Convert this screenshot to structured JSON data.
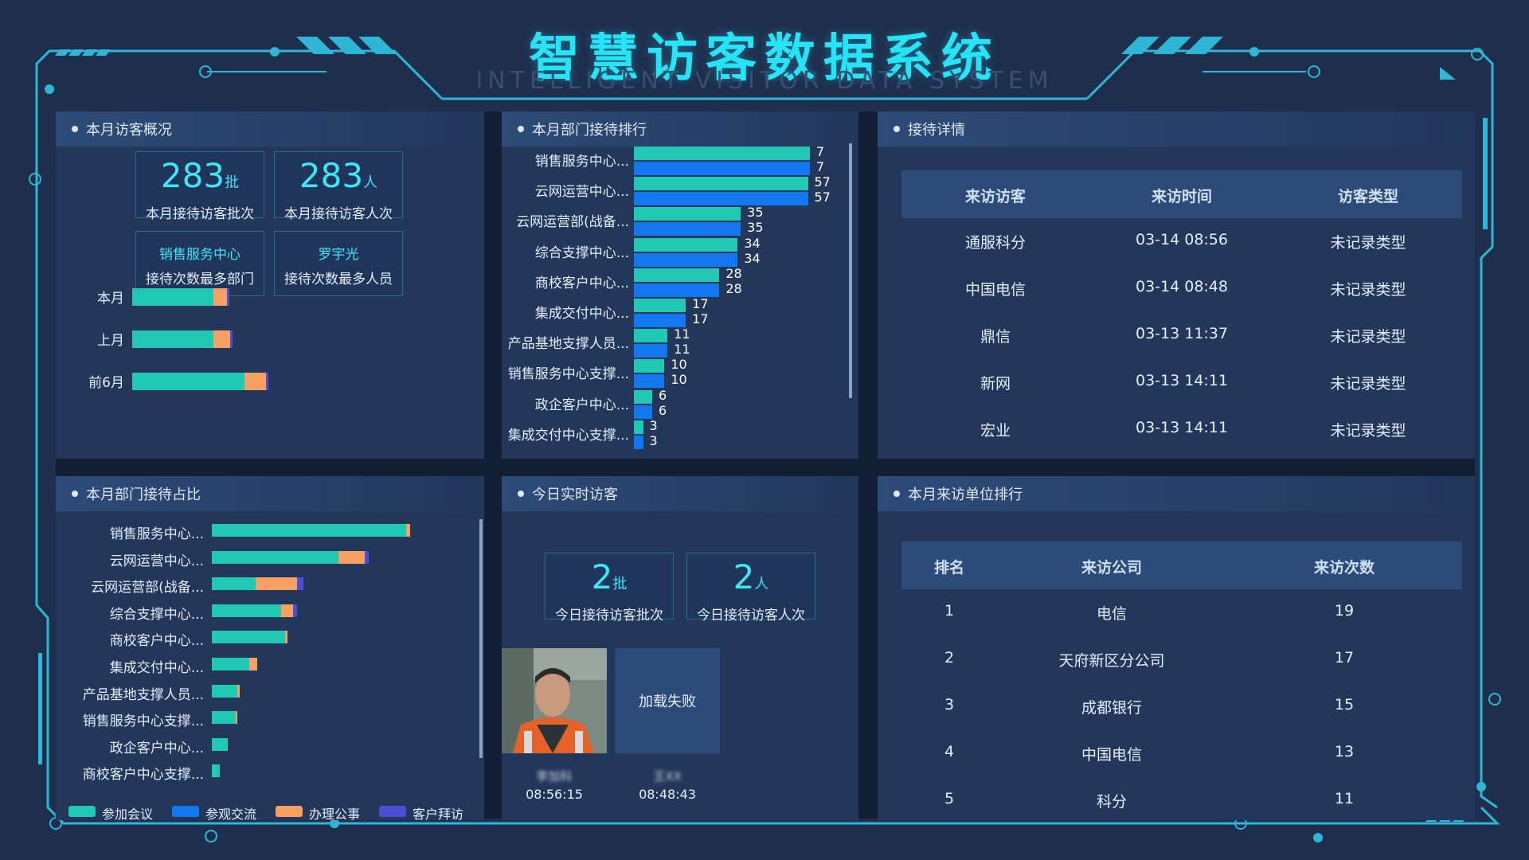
{
  "header": {
    "title": "智慧访客数据系统",
    "subtitle": "INTELLIGENT VISITOR DATA SYSTEM"
  },
  "overview": {
    "title": "本月访客概况",
    "batches": {
      "value": "283",
      "unit": "批",
      "label": "本月接待访客批次"
    },
    "people": {
      "value": "283",
      "unit": "人",
      "label": "本月接待访客人次"
    },
    "top_dept": {
      "value": "销售服务中心",
      "label": "接待次数最多部门"
    },
    "top_person": {
      "value": "罗宇光",
      "label": "接待次数最多人员"
    },
    "period_bars": [
      {
        "label": "本月",
        "segments": [
          0.68,
          0.11,
          0.02
        ]
      },
      {
        "label": "上月",
        "segments": [
          0.68,
          0.14,
          0.02
        ]
      },
      {
        "label": "前6月",
        "segments": [
          0.94,
          0.18,
          0.02
        ]
      }
    ]
  },
  "ranking": {
    "title": "本月部门接待排行",
    "items": [
      {
        "label": "销售服务中心...",
        "a": 7,
        "b": 7
      },
      {
        "label": "云网运营中心...",
        "a": 57,
        "b": 57
      },
      {
        "label": "云网运营部(战备...",
        "a": 35,
        "b": 35
      },
      {
        "label": "综合支撑中心...",
        "a": 34,
        "b": 34
      },
      {
        "label": "商校客户中心...",
        "a": 28,
        "b": 28
      },
      {
        "label": "集成交付中心...",
        "a": 17,
        "b": 17
      },
      {
        "label": "产品基地支撑人员...",
        "a": 11,
        "b": 11
      },
      {
        "label": "销售服务中心支撑...",
        "a": 10,
        "b": 10
      },
      {
        "label": "政企客户中心...",
        "a": 6,
        "b": 6
      },
      {
        "label": "集成交付中心支撑...",
        "a": 3,
        "b": 3
      }
    ],
    "first_bar_fill": [
      0.98,
      0.98
    ]
  },
  "details": {
    "title": "接待详情",
    "headers": [
      "来访访客",
      "来访时间",
      "访客类型"
    ],
    "rows": [
      [
        "通服科分",
        "03-14 08:56",
        "未记录类型"
      ],
      [
        "中国电信",
        "03-14 08:48",
        "未记录类型"
      ],
      [
        "鼎信",
        "03-13 11:37",
        "未记录类型"
      ],
      [
        "新网",
        "03-13 14:11",
        "未记录类型"
      ],
      [
        "宏业",
        "03-13 14:11",
        "未记录类型"
      ]
    ]
  },
  "ratio": {
    "title": "本月部门接待占比",
    "items": [
      {
        "label": "销售服务中心...",
        "segments": [
          0.98,
          0,
          0.02,
          0
        ]
      },
      {
        "label": "云网运营中心...",
        "segments": [
          0.64,
          0,
          0.13,
          0.02
        ]
      },
      {
        "label": "云网运营部(战备...",
        "segments": [
          0.22,
          0,
          0.21,
          0.03
        ]
      },
      {
        "label": "综合支撑中心...",
        "segments": [
          0.35,
          0,
          0.06,
          0.02
        ]
      },
      {
        "label": "商校客户中心...",
        "segments": [
          0.37,
          0,
          0.01,
          0
        ]
      },
      {
        "label": "集成交付中心...",
        "segments": [
          0.19,
          0,
          0.04,
          0
        ]
      },
      {
        "label": "产品基地支撑人员...",
        "segments": [
          0.13,
          0,
          0.01,
          0
        ]
      },
      {
        "label": "销售服务中心支撑...",
        "segments": [
          0.12,
          0,
          0.01,
          0
        ]
      },
      {
        "label": "政企客户中心...",
        "segments": [
          0.08,
          0,
          0,
          0
        ]
      },
      {
        "label": "商校客户中心支撑...",
        "segments": [
          0.04,
          0,
          0,
          0
        ]
      }
    ],
    "legend": [
      {
        "label": "参加会议",
        "color": "#21c9b4"
      },
      {
        "label": "参观交流",
        "color": "#1377f0"
      },
      {
        "label": "办理公事",
        "color": "#f7a063"
      },
      {
        "label": "客户拜访",
        "color": "#4a4fd6"
      }
    ]
  },
  "realtime": {
    "title": "今日实时访客",
    "batches": {
      "value": "2",
      "unit": "批",
      "label": "今日接待访客批次"
    },
    "people": {
      "value": "2",
      "unit": "人",
      "label": "今日接待访客人次"
    },
    "visitors": [
      {
        "name": "李加科",
        "time": "08:56:15",
        "photo": "visitor-photo"
      },
      {
        "name": "王XX",
        "time": "08:48:43",
        "photo_status": "加载失败"
      }
    ]
  },
  "units": {
    "title": "本月来访单位排行",
    "headers": [
      "排名",
      "来访公司",
      "来访次数"
    ],
    "rows": [
      [
        "1",
        "电信",
        "19"
      ],
      [
        "2",
        "天府新区分公司",
        "17"
      ],
      [
        "3",
        "成都银行",
        "15"
      ],
      [
        "4",
        "中国电信",
        "13"
      ],
      [
        "5",
        "科分",
        "11"
      ]
    ]
  },
  "colors": {
    "teal": "#21c9b4",
    "blue": "#1377f0",
    "orange": "#f7a063",
    "purple": "#4a4fd6",
    "accent": "#27e3f6"
  }
}
